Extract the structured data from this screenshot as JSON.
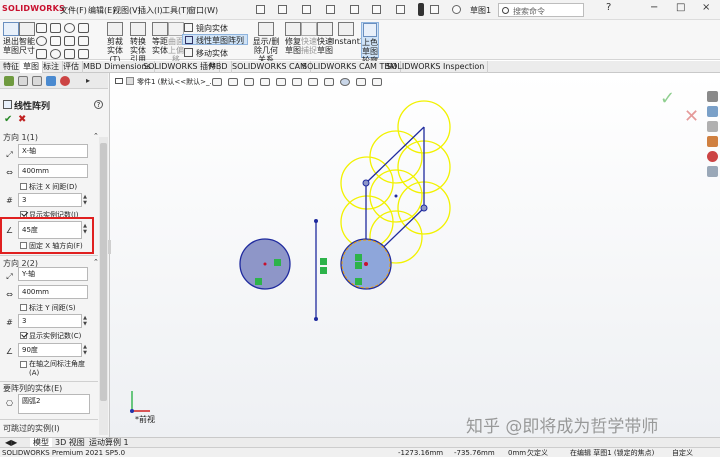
{
  "app": {
    "logo": "SOLIDWORKS",
    "document_title": "草图1",
    "search_placeholder": "搜索命令"
  },
  "menu": [
    "文件(F)",
    "编辑(E)",
    "视图(V)",
    "插入(I)",
    "工具(T)",
    "窗口(W)"
  ],
  "ribbon": {
    "exit_sketch": "退出草图",
    "smart_dimension": "智能尺寸",
    "trim": "剪裁实体(T)",
    "convert": "转换实体引用",
    "offset": "等距实体",
    "surface_offset": "曲面上偏移",
    "mirror": "镜向实体",
    "linear_pattern": "线性草图阵列",
    "move": "移动实体",
    "display_delete_relations": "显示/删除几何关系",
    "repair": "修复草图",
    "quick_snap": "快速捕捉",
    "rapid_sketch": "快速草图",
    "instant2d": "Instant2D",
    "shaded_sketch": "上色草图轮廓"
  },
  "tabs": [
    "特征",
    "草图",
    "标注",
    "评估",
    "MBD Dimensions",
    "SOLIDWORKS 插件",
    "MBD",
    "SOLIDWORKS CAM",
    "SOLIDWORKS CAM TBM",
    "SOLIDWORKS Inspection"
  ],
  "active_tab": "草图",
  "tree": {
    "part_name": "零件1 (默认<<默认>_..."
  },
  "property_manager": {
    "title": "线性阵列",
    "direction1": {
      "header": "方向 1(1)",
      "axis": "X-轴",
      "spacing": "400mm",
      "dim_x_spacing_label": "标注 X 间距(D)",
      "count": "3",
      "show_count_label": "显示实例记数(I)",
      "angle": "45度",
      "fix_x_axis_label": "固定 X 轴方向(F)"
    },
    "direction2": {
      "header": "方向 2(2)",
      "axis": "Y-轴",
      "spacing": "400mm",
      "dim_y_spacing_label": "标注 Y 间距(S)",
      "count": "3",
      "show_count_label": "显示实例记数(C)",
      "angle": "90度",
      "dim_angle_label": "在轴之间标注角度(A)"
    },
    "entities": {
      "header": "要阵列的实体(E)",
      "item": "圆弧2"
    },
    "skip_header": "可跳过的实例(I)"
  },
  "view": {
    "label": "*前视"
  },
  "bottom_tabs": [
    "模型",
    "3D 视图",
    "运动算例 1"
  ],
  "status": {
    "product": "SOLIDWORKS Premium 2021 SP5.0",
    "x": "-1273.16mm",
    "y": "-735.76mm",
    "z": "0mm",
    "defined": "欠定义",
    "editing": "在编辑 草图1 (锁定的焦点)",
    "custom": "自定义"
  },
  "watermark": "知乎 @即将成为哲学带师",
  "colors": {
    "accent_red": "#e02020",
    "sketch_blue": "#1f2a9e",
    "pattern_yellow": "#f0f000",
    "circle_fill": "#8e96c8"
  }
}
